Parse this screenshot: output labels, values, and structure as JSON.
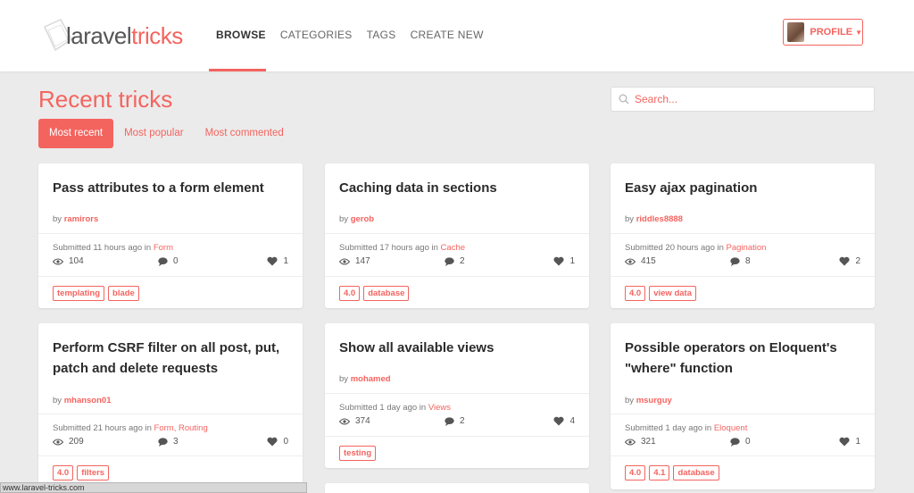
{
  "brand": {
    "part1": "laravel",
    "part2": "tricks"
  },
  "nav": {
    "items": [
      "BROWSE",
      "CATEGORIES",
      "TAGS",
      "CREATE NEW"
    ]
  },
  "profile": {
    "label": "PROFILE"
  },
  "page": {
    "title": "Recent tricks"
  },
  "filters": [
    "Most recent",
    "Most popular",
    "Most commented"
  ],
  "search": {
    "placeholder": "Search..."
  },
  "cards": [
    {
      "title": "Pass attributes to a form element",
      "author": "ramirors",
      "submitted": "Submitted 11 hours ago in ",
      "categories": "Form",
      "views": "104",
      "comments": "0",
      "likes": "1",
      "tags": [
        "templating",
        "blade"
      ]
    },
    {
      "title": "Caching data in sections",
      "author": "gerob",
      "submitted": "Submitted 17 hours ago in ",
      "categories": "Cache",
      "views": "147",
      "comments": "2",
      "likes": "1",
      "tags": [
        "4.0",
        "database"
      ]
    },
    {
      "title": "Easy ajax pagination",
      "author": "riddles8888",
      "submitted": "Submitted 20 hours ago in ",
      "categories": "Pagination",
      "views": "415",
      "comments": "8",
      "likes": "2",
      "tags": [
        "4.0",
        "view data"
      ]
    },
    {
      "title": "Perform CSRF filter on all post, put, patch and delete requests",
      "author": "mhanson01",
      "submitted": "Submitted 21 hours ago in ",
      "categories": "Form, Routing",
      "views": "209",
      "comments": "3",
      "likes": "0",
      "tags": [
        "4.0",
        "filters"
      ]
    },
    {
      "title": "Show all available views",
      "author": "mohamed",
      "submitted": "Submitted 1 day ago in ",
      "categories": "Views",
      "views": "374",
      "comments": "2",
      "likes": "4",
      "tags": [
        "testing"
      ]
    },
    {
      "title": "Possible operators on Eloquent's \"where\" function",
      "author": "msurguy",
      "submitted": "Submitted 1 day ago in ",
      "categories": "Eloquent",
      "views": "321",
      "comments": "0",
      "likes": "1",
      "tags": [
        "4.0",
        "4.1",
        "database"
      ]
    }
  ],
  "by_label": "by ",
  "status_url": "www.laravel-tricks.com",
  "colors": {
    "accent": "#f4645f",
    "background": "#ebebeb"
  }
}
